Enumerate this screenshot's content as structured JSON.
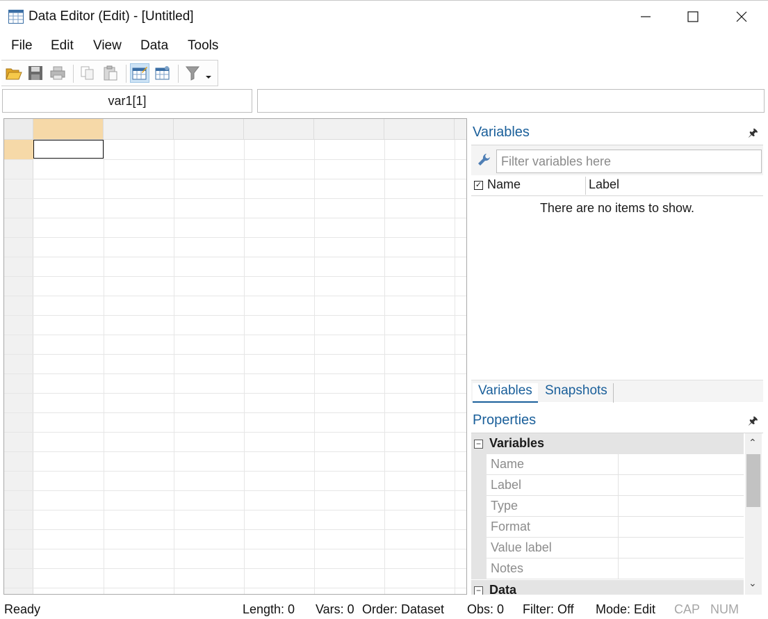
{
  "window": {
    "title": "Data Editor (Edit) - [Untitled]"
  },
  "menu": {
    "items": [
      "File",
      "Edit",
      "View",
      "Data",
      "Tools"
    ]
  },
  "toolbar": {
    "icons": [
      "open-icon",
      "save-icon",
      "print-icon",
      "copy-icon",
      "paste-icon",
      "data-editor-browse-icon",
      "variables-manager-icon",
      "filter-icon"
    ]
  },
  "editor": {
    "cell_name": "var1[1]",
    "cell_value": ""
  },
  "variables_panel": {
    "title": "Variables",
    "filter_placeholder": "Filter variables here",
    "col_name": "Name",
    "col_label": "Label",
    "empty_message": "There are no items to show.",
    "tabs": [
      "Variables",
      "Snapshots"
    ]
  },
  "properties_panel": {
    "title": "Properties",
    "category_variables": "Variables",
    "rows": [
      "Name",
      "Label",
      "Type",
      "Format",
      "Value label",
      "Notes"
    ],
    "category_data": "Data"
  },
  "status": {
    "ready": "Ready",
    "length": "Length: 0",
    "vars": "Vars: 0",
    "order": "Order: Dataset",
    "obs": "Obs: 0",
    "filter": "Filter: Off",
    "mode": "Mode: Edit",
    "cap": "CAP",
    "num": "NUM"
  }
}
